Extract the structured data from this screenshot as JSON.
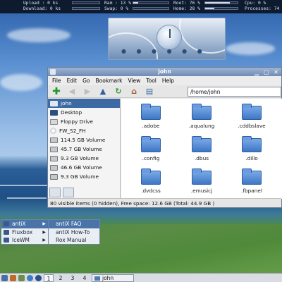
{
  "conky": {
    "upload": "Upload : 0 ks",
    "download": "Download: 0 ks",
    "ram": "Ram : 13 %",
    "swap": "Swap: 0 %",
    "root": "Root: 76 %",
    "home": "Home: 28 %",
    "cpu": "Cpu: 0 %",
    "processes": "Processes: 74",
    "levels": {
      "ram": 0.13,
      "swap": 0.0,
      "root": 0.76,
      "home": 0.28,
      "cpu": 0.0
    }
  },
  "window": {
    "title": "john",
    "menus": [
      "File",
      "Edit",
      "Go",
      "Bookmark",
      "View",
      "Tool",
      "Help"
    ],
    "path": "/home/john",
    "toolbar_icons": [
      "add-icon",
      "back-icon",
      "forward-icon",
      "up-icon",
      "reload-icon",
      "home-icon",
      "drive-icon"
    ],
    "sidebar": [
      {
        "label": "john",
        "icon": "home-icon",
        "selected": true
      },
      {
        "label": "Desktop",
        "icon": "desktop-icon"
      },
      {
        "label": "Floppy Drive",
        "icon": "floppy-icon"
      },
      {
        "label": "FW_S2_FH",
        "icon": "cdrom-icon"
      },
      {
        "label": "114.5 GB Volume",
        "icon": "disk-icon"
      },
      {
        "label": "45.7 GB Volume",
        "icon": "disk-icon"
      },
      {
        "label": "9.3 GB Volume",
        "icon": "disk-icon"
      },
      {
        "label": "46.6 GB Volume",
        "icon": "disk-icon"
      },
      {
        "label": "9.3 GB Volume",
        "icon": "disk-icon"
      }
    ],
    "files": [
      ".adobe",
      ".aqualung",
      ".cddbslave",
      ".config",
      ".dbus",
      ".dillo",
      ".dvdcss",
      ".emusicj",
      ".fbpanel"
    ],
    "status": "80 visible items (0 hidden), Free space: 12.6 GB (Total: 44.9 GB )"
  },
  "menu": {
    "main": [
      "antiX",
      "Fluxbox",
      "IceWM"
    ],
    "sub": [
      "antiX FAQ",
      "antiX How-To",
      "Rox Manual"
    ]
  },
  "taskbar": {
    "workspaces": [
      "1",
      "2",
      "3",
      "4"
    ],
    "task": "john"
  }
}
